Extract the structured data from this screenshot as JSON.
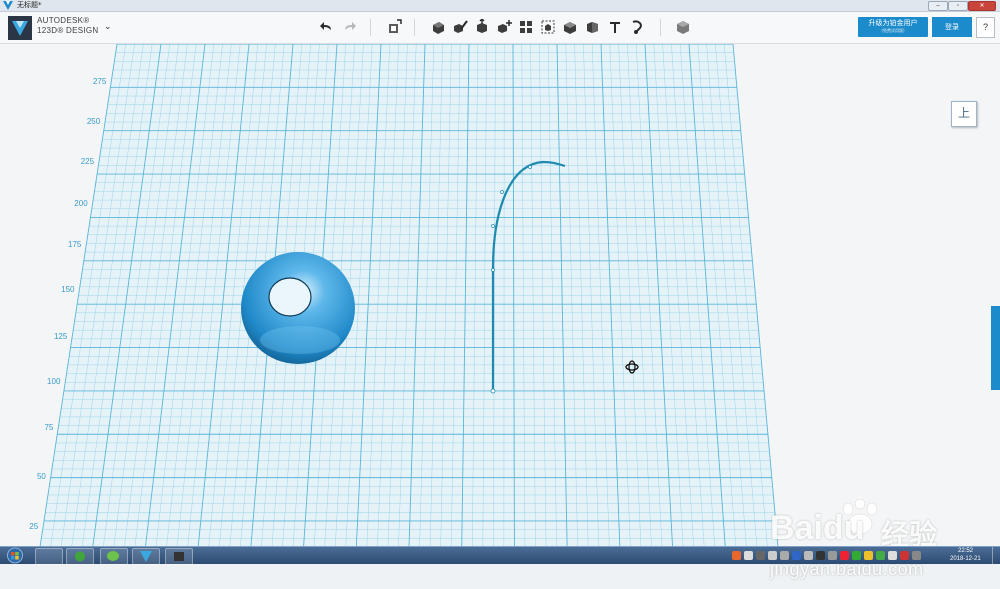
{
  "window": {
    "title": "无标题*",
    "minimize_symbol": "–",
    "maximize_symbol": "▫",
    "close_symbol": "✕"
  },
  "toolbar": {
    "brand_line1": "AUTODESK®",
    "brand_line2": "123D® DESIGN",
    "menu_symbol": "⌄",
    "icons": [
      "undo-icon",
      "redo-icon",
      "transform-icon",
      "primitives-icon",
      "sketch-icon",
      "construct-icon",
      "modify-icon",
      "pattern-icon",
      "grouping-icon",
      "combine-icon",
      "measure-icon",
      "text-icon",
      "snap-icon",
      "material-icon"
    ],
    "upgrade_label": "升级为铂金用户",
    "upgrade_sublabel": "(免费试用版)",
    "login_label": "登录",
    "help_label": "?"
  },
  "viewcube": {
    "face_label": "上"
  },
  "grid": {
    "axis_labels": [
      "275",
      "250",
      "225",
      "200",
      "175",
      "150",
      "125",
      "100",
      "75",
      "50",
      "25"
    ]
  },
  "watermark": {
    "brand": "Bai",
    "brand_suffix": "du",
    "brand_cn": "经验",
    "url": "jingyan.baidu.com"
  },
  "taskbar": {
    "time": "22:52",
    "date": "2018-12-21"
  },
  "colors": {
    "accent": "#1c8bcb",
    "grid_line": "#7fc6e0",
    "grid_major": "#4fb0d6",
    "sphere": "#2e95d3",
    "sketch_line": "#1e8ab0"
  }
}
